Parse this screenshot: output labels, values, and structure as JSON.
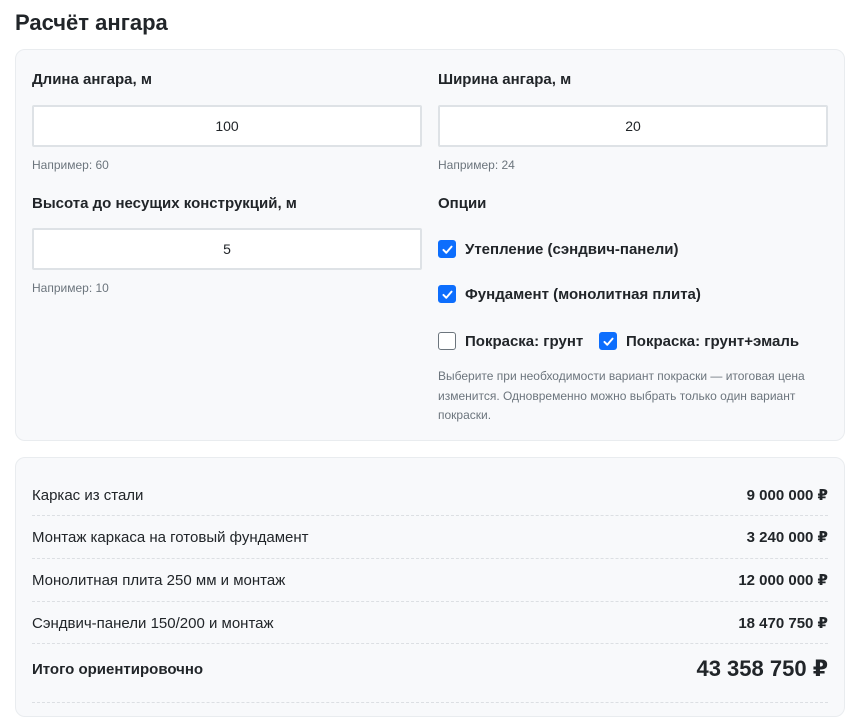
{
  "page": {
    "title": "Расчёт ангара"
  },
  "form": {
    "length": {
      "label": "Длина ангара, м",
      "value": "100",
      "hint": "Например: 60"
    },
    "width": {
      "label": "Ширина ангара, м",
      "value": "20",
      "hint": "Например: 24"
    },
    "height": {
      "label": "Высота до несущих конструкций, м",
      "value": "5",
      "hint": "Например: 10"
    },
    "options": {
      "title": "Опции",
      "insulation": {
        "label": "Утепление (сэндвич-панели)",
        "checked": true
      },
      "foundation": {
        "label": "Фундамент (монолитная плита)",
        "checked": true
      },
      "paint_primer": {
        "label": "Покраска: грунт",
        "checked": false
      },
      "paint_enamel": {
        "label": "Покраска: грунт+эмаль",
        "checked": true
      },
      "paint_note": "Выберите при необходимости вариант покраски — итоговая цена изменится. Одновременно можно выбрать только один вариант покраски."
    }
  },
  "results": {
    "items": [
      {
        "label": "Каркас из стали",
        "value": "9 000 000 ₽"
      },
      {
        "label": "Монтаж каркаса на готовый фундамент",
        "value": "3 240 000 ₽"
      },
      {
        "label": "Монолитная плита 250 мм и монтаж",
        "value": "12 000 000 ₽"
      },
      {
        "label": "Сэндвич-панели 150/200 и монтаж",
        "value": "18 470 750 ₽"
      }
    ],
    "total": {
      "label": "Итого ориентировочно",
      "value": "43 358 750 ₽"
    }
  },
  "colors": {
    "accent": "#0d6efd",
    "panel_bg": "#f8f9fb"
  },
  "icons": {
    "checkbox_checked": "check-icon"
  }
}
